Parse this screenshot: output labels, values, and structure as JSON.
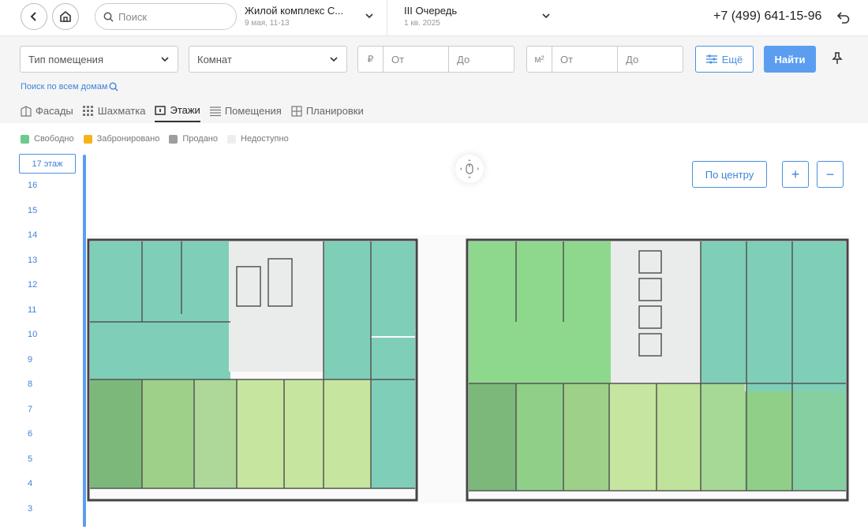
{
  "header": {
    "back_icon": "chevron-left-icon",
    "home_icon": "home-icon",
    "search_placeholder": "Поиск",
    "project_title": "Жилой комплекс С...",
    "project_date": "9 мая, 11-13",
    "queue_title": "III Очередь",
    "queue_date": "1 кв. 2025",
    "phone": "+7 (499) 641-15-96",
    "undo_icon": "undo-icon"
  },
  "filters": {
    "room_type": "Тип помещения",
    "rooms": "Комнат",
    "price_unit": "₽",
    "price_from": "От",
    "price_to": "До",
    "area_unit": "м²",
    "area_from": "От",
    "area_to": "До",
    "more_label": "Ещё",
    "find_label": "Найти",
    "search_all_houses": "Поиск по всем домам"
  },
  "tabs": [
    {
      "label": "Фасады",
      "icon": "building-icon"
    },
    {
      "label": "Шахматка",
      "icon": "grid-icon"
    },
    {
      "label": "Этажи",
      "icon": "floor-icon",
      "active": true
    },
    {
      "label": "Помещения",
      "icon": "list-icon"
    },
    {
      "label": "Планировки",
      "icon": "layout-icon"
    }
  ],
  "legend": [
    {
      "label": "Свободно",
      "color": "#6ccb8e"
    },
    {
      "label": "Забронировано",
      "color": "#f5b21b"
    },
    {
      "label": "Продано",
      "color": "#9e9e9e"
    },
    {
      "label": "Недоступно",
      "color": "#eeeeee"
    }
  ],
  "floors": {
    "selected": "17 этаж",
    "list": [
      "16",
      "15",
      "14",
      "13",
      "12",
      "11",
      "10",
      "9",
      "8",
      "7",
      "6",
      "5",
      "4",
      "3"
    ]
  },
  "controls": {
    "center_label": "По центру",
    "zoom_in": "+",
    "zoom_out": "−",
    "mouse_icon": "mouse-drag-icon"
  },
  "colors": {
    "accent": "#4a90e2",
    "free_teal": "#7fcfb8",
    "free_green": "#8ed88e",
    "free_lime": "#c6e6a0",
    "free_olive": "#7bb87a"
  }
}
